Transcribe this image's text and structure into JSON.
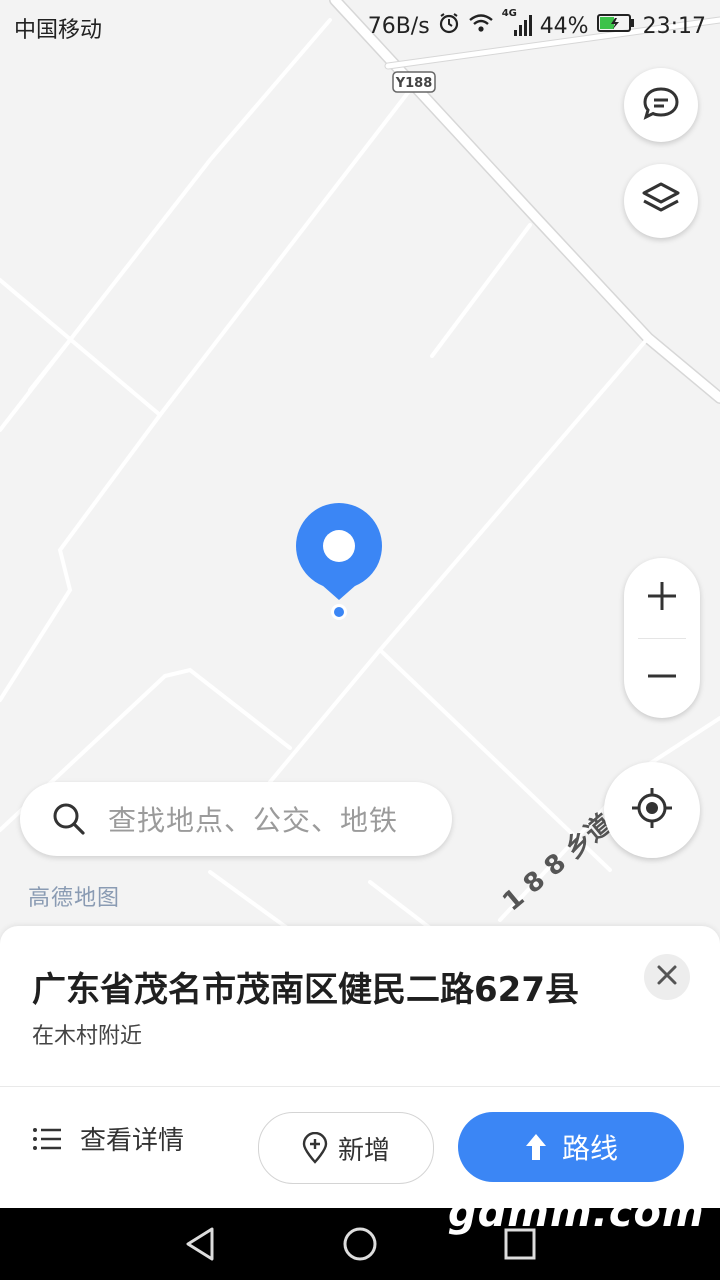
{
  "status_bar": {
    "carrier": "中国移动",
    "net_speed": "76B/s",
    "signal_label": "4G",
    "battery": "44%",
    "time": "23:17"
  },
  "map": {
    "road_badge": "Y188",
    "road_label": "1 8 8 乡道",
    "brand": "高德地图"
  },
  "search": {
    "placeholder": "查找地点、公交、地铁"
  },
  "controls": {
    "icons": [
      "message-icon",
      "layers-icon",
      "zoom-in-icon",
      "zoom-out-icon",
      "locate-icon"
    ]
  },
  "place": {
    "title": "广东省茂名市茂南区健民二路627县",
    "subtitle": "在木村附近"
  },
  "actions": {
    "details_label": "查看详情",
    "add_label": "新增",
    "route_label": "路线"
  },
  "watermark": "gdmm.com",
  "colors": {
    "accent": "#3b86f5",
    "map_bg": "#f3f3f3",
    "road": "#ffffff"
  }
}
